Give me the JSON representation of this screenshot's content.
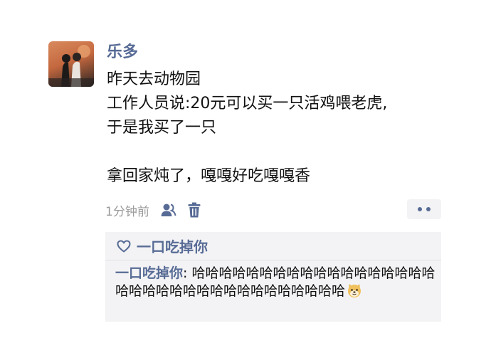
{
  "post": {
    "username": "乐多",
    "lines": [
      "昨天去动物园",
      "工作人员说:20元可以买一只活鸡喂老虎,",
      "于是我买了一只",
      "",
      "拿回家炖了，嘎嘎好吃嘎嘎香"
    ],
    "time": "1分钟前"
  },
  "likes": {
    "names": "一口吃掉你"
  },
  "comments": [
    {
      "author": "一口吃掉你",
      "separator": ": ",
      "text": "哈哈哈哈哈哈哈哈哈哈哈哈哈哈哈哈哈哈哈哈哈哈哈哈哈哈哈哈哈哈哈哈哈哈哈",
      "emoji": "doge-emoji"
    }
  ],
  "colors": {
    "link": "#576b95",
    "text": "#111111",
    "meta": "#9b9b9b",
    "panel": "#f3f3f5"
  },
  "icons": [
    "privacy-person-icon",
    "trash-icon",
    "heart-outline-icon"
  ]
}
